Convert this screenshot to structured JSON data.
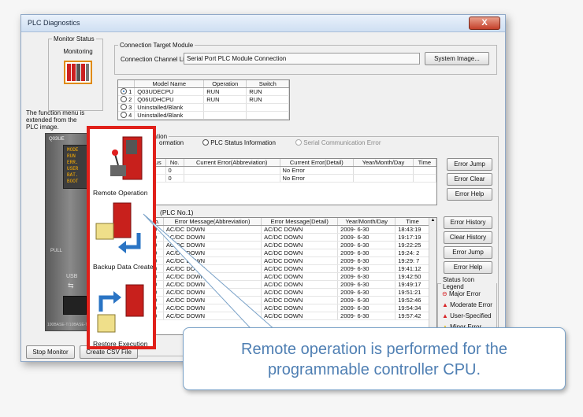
{
  "window": {
    "title": "PLC Diagnostics",
    "close_glyph": "X"
  },
  "monitor_status": {
    "legend": "Monitor Status",
    "state": "Monitoring"
  },
  "connection": {
    "legend": "Connection Target Module",
    "channel_label": "Connection Channel List",
    "channel_value": "Serial Port  PLC Module Connection",
    "system_image_button": "System Image..."
  },
  "model_table": {
    "headers": [
      "",
      "Model Name",
      "Operation",
      "Switch"
    ],
    "rows": [
      {
        "num": "1",
        "model": "Q03UDECPU",
        "operation": "RUN",
        "switch": "RUN",
        "selected": true
      },
      {
        "num": "2",
        "model": "Q06UDHCPU",
        "operation": "RUN",
        "switch": "RUN",
        "selected": false
      },
      {
        "num": "3",
        "model": "Uninstalled/Blank",
        "operation": "",
        "switch": "",
        "selected": false
      },
      {
        "num": "4",
        "model": "Uninstalled/Blank",
        "operation": "",
        "switch": "",
        "selected": false
      }
    ]
  },
  "side_note": "The function menu is extended from the PLC image.",
  "plc_image": {
    "module_label": "Q03UE",
    "leds": [
      "MODE",
      "RUN",
      "ERR.",
      "USER",
      "BAT.",
      "BOOT"
    ],
    "pull_label": "PULL",
    "usb_label": "USB",
    "bottom_label": "100BASE-T/10BASE-T"
  },
  "error_info": {
    "legend": "Error Information",
    "tab1": "ormation",
    "tab2": "PLC Status Information",
    "tab3": "Serial Communication Error",
    "current_headers": [
      "us",
      "No.",
      "Current Error(Abbreviation)",
      "Current Error(Detail)",
      "Year/Month/Day",
      "Time"
    ],
    "current_rows": [
      {
        "no": "0",
        "abbr": "",
        "detail": "No Error",
        "date": "",
        "time": ""
      },
      {
        "no": "0",
        "abbr": "",
        "detail": "No Error",
        "date": "",
        "time": ""
      }
    ],
    "buttons_right": [
      "Error Jump",
      "Error Clear",
      "Error Help"
    ],
    "history_title": "(PLC No.1)",
    "history_headers": [
      "o.",
      "Error Message(Abbreviation)",
      "Error Message(Detail)",
      "Year/Month/Day",
      "Time"
    ],
    "history_rows": [
      {
        "no": "0",
        "abbr": "AC/DC DOWN",
        "detail": "AC/DC DOWN",
        "date": "2009- 6-30",
        "time": "18:43:19"
      },
      {
        "no": "0",
        "abbr": "AC/DC DOWN",
        "detail": "AC/DC DOWN",
        "date": "2009- 6-30",
        "time": "19:17:19"
      },
      {
        "no": "0",
        "abbr": "AC/DC DOWN",
        "detail": "AC/DC DOWN",
        "date": "2009- 6-30",
        "time": "19:22:25"
      },
      {
        "no": "0",
        "abbr": "AC/DC DOWN",
        "detail": "AC/DC DOWN",
        "date": "2009- 6-30",
        "time": "19:24: 2"
      },
      {
        "no": "0",
        "abbr": "AC/DC DOWN",
        "detail": "AC/DC DOWN",
        "date": "2009- 6-30",
        "time": "19:29: 7"
      },
      {
        "no": "0",
        "abbr": "AC/DC DOWN",
        "detail": "AC/DC DOWN",
        "date": "2009- 6-30",
        "time": "19:41:12"
      },
      {
        "no": "0",
        "abbr": "AC/DC DOWN",
        "detail": "AC/DC DOWN",
        "date": "2009- 6-30",
        "time": "19:42:50"
      },
      {
        "no": "0",
        "abbr": "AC/DC DOWN",
        "detail": "AC/DC DOWN",
        "date": "2009- 6-30",
        "time": "19:49:17"
      },
      {
        "no": "0",
        "abbr": "AC/DC DOWN",
        "detail": "AC/DC DOWN",
        "date": "2009- 6-30",
        "time": "19:51:21"
      },
      {
        "no": "0",
        "abbr": "AC/DC DOWN",
        "detail": "AC/DC DOWN",
        "date": "2009- 6-30",
        "time": "19:52:46"
      },
      {
        "no": "0",
        "abbr": "AC/DC DOWN",
        "detail": "AC/DC DOWN",
        "date": "2009- 6-30",
        "time": "19:54:34"
      },
      {
        "no": "0",
        "abbr": "AC/DC DOWN",
        "detail": "AC/DC DOWN",
        "date": "2009- 6-30",
        "time": "19:57:42"
      }
    ],
    "history_buttons": [
      "Error History",
      "Clear History",
      "Error Jump",
      "Error Help"
    ],
    "status_legend": {
      "title": "Status Icon Legend",
      "items": [
        {
          "label": "Major Error",
          "color": "#d8262a"
        },
        {
          "label": "Moderate Error",
          "color": "#d8262a"
        },
        {
          "label": "User-Specified",
          "color": "#d8262a"
        },
        {
          "label": "Minor Error",
          "color": "#e8c01a"
        }
      ]
    }
  },
  "popup_menu": {
    "items": [
      {
        "label": "Remote Operation",
        "icon": "remote-operation-icon"
      },
      {
        "label": "Backup Data Create",
        "icon": "backup-data-icon"
      },
      {
        "label": "Restore Execution",
        "icon": "restore-execution-icon"
      }
    ]
  },
  "bottom_buttons": {
    "stop_monitor": "Stop Monitor",
    "create_csv": "Create CSV File"
  },
  "callout": {
    "text": "Remote operation is performed for the programmable controller CPU."
  },
  "colors": {
    "highlight_red": "#e0201a",
    "callout_text": "#4f7fb3"
  }
}
